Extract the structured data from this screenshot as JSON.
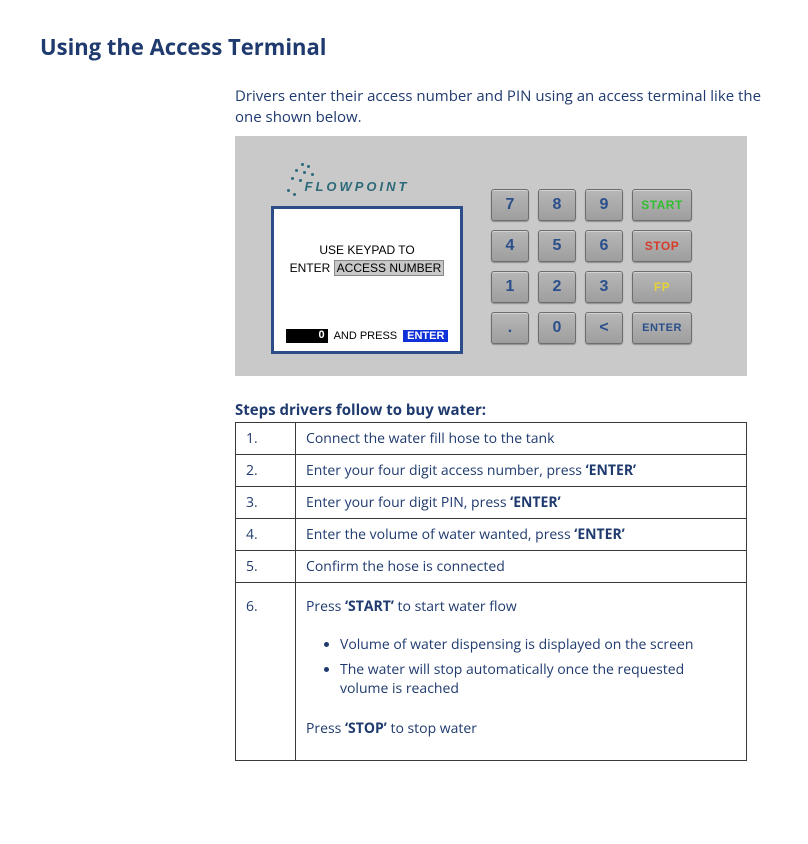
{
  "title": "Using the Access Terminal",
  "intro": "Drivers enter their access number and PIN using an access terminal like the one shown below.",
  "terminal": {
    "brand": "FLOWPOINT",
    "screen": {
      "line1": "USE KEYPAD TO",
      "line2_prefix": "ENTER",
      "line2_highlight": "ACCESS NUMBER",
      "input_value": "0",
      "and_press": "AND PRESS",
      "enter_label": "ENTER"
    },
    "keys": {
      "r1": [
        "7",
        "8",
        "9"
      ],
      "r1fn": "START",
      "r2": [
        "4",
        "5",
        "6"
      ],
      "r2fn": "STOP",
      "r3": [
        "1",
        "2",
        "3"
      ],
      "r3fn": "FP",
      "r4": [
        ".",
        "0",
        "<"
      ],
      "r4fn": "ENTER"
    }
  },
  "steps_title": "Steps drivers follow to buy water:",
  "steps": {
    "s1": {
      "n": "1.",
      "text": "Connect the water fill hose to the tank"
    },
    "s2": {
      "n": "2.",
      "pre": "Enter your four digit access number, press ",
      "b": "‘ENTER’"
    },
    "s3": {
      "n": "3.",
      "pre": "Enter your four digit PIN, press ",
      "b": "‘ENTER’"
    },
    "s4": {
      "n": "4.",
      "pre": "Enter the volume of water wanted, press ",
      "b": "‘ENTER’"
    },
    "s5": {
      "n": "5.",
      "text": "Confirm the hose is connected"
    },
    "s6": {
      "n": "6.",
      "press_pre": "Press  ",
      "press_b": "‘START’",
      "press_post": " to start water flow",
      "bullets": [
        "Volume of water dispensing is displayed on the screen",
        "The water will stop automatically once the requested volume is reached"
      ],
      "stop_pre": "Press ",
      "stop_b": "‘STOP’",
      "stop_post": " to stop water"
    }
  }
}
